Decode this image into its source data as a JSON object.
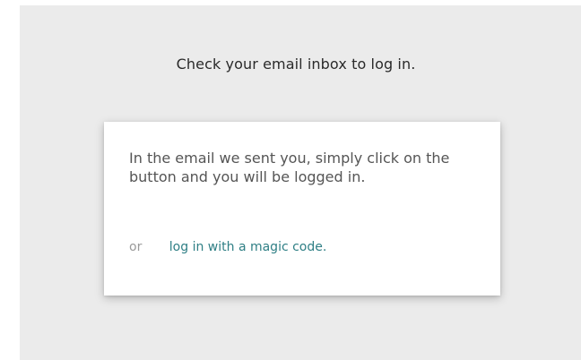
{
  "login_prompt": {
    "heading": "Check your email inbox to log in.",
    "instructions": "In the email we sent you, simply click on the button and you will be logged in.",
    "alternative_prefix": "or",
    "magic_code_link": "log in with a magic code."
  },
  "colors": {
    "background": "#ebebeb",
    "card": "#ffffff",
    "link": "#2f7f85"
  }
}
